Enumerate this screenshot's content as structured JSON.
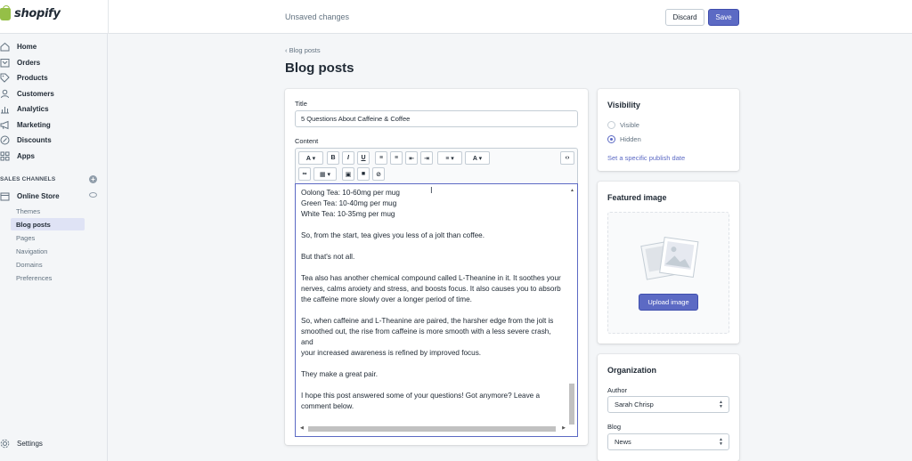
{
  "app": {
    "logo_text": "shopify",
    "brand_color": "#95bf47",
    "accent": "#5c6ac4"
  },
  "topbar": {
    "status": "Unsaved changes",
    "discard_label": "Discard",
    "save_label": "Save"
  },
  "sidebar": {
    "items": [
      {
        "label": "Home",
        "icon": "home-icon"
      },
      {
        "label": "Orders",
        "icon": "orders-icon"
      },
      {
        "label": "Products",
        "icon": "tag-icon"
      },
      {
        "label": "Customers",
        "icon": "person-icon"
      },
      {
        "label": "Analytics",
        "icon": "chart-icon"
      },
      {
        "label": "Marketing",
        "icon": "megaphone-icon"
      },
      {
        "label": "Discounts",
        "icon": "discount-icon"
      },
      {
        "label": "Apps",
        "icon": "apps-icon"
      }
    ],
    "section_title": "SALES CHANNELS",
    "channel": {
      "label": "Online Store",
      "icon": "store-icon"
    },
    "sub_items": [
      "Themes",
      "Blog posts",
      "Pages",
      "Navigation",
      "Domains",
      "Preferences"
    ],
    "settings_label": "Settings"
  },
  "main": {
    "breadcrumb": "Blog posts",
    "title": "Blog posts",
    "title_label": "Title",
    "title_value": "5 Questions About Caffeine & Coffee",
    "content_label": "Content",
    "editor_lines": [
      [
        "Oolong Tea: 10-60mg per mug",
        "Green Tea: 10-40mg per mug",
        "White Tea: 10-35mg per mug"
      ],
      [
        "So, from the start, tea gives you less of a jolt than coffee."
      ],
      [
        "But that's not all."
      ],
      [
        "Tea also has another chemical compound called L-Theanine in it. It soothes your",
        "nerves, calms anxiety and stress, and boosts focus. It also causes you to absorb",
        "the caffeine more slowly over a longer period of time."
      ],
      [
        "So, when caffeine and L-Theanine are paired, the harsher edge from the jolt is",
        "smoothed out, the rise from caffeine is more smooth with a less severe crash, and",
        "your increased awareness is refined by improved focus."
      ],
      [
        "They make a great pair."
      ],
      [
        "I hope this post answered some of your questions! Got anymore? Leave a",
        "comment below."
      ]
    ]
  },
  "visibility": {
    "title": "Visibility",
    "options": [
      {
        "label": "Visible",
        "selected": false
      },
      {
        "label": "Hidden",
        "selected": true
      }
    ],
    "link": "Set a specific publish date"
  },
  "featured": {
    "title": "Featured image",
    "upload_label": "Upload image"
  },
  "organization": {
    "title": "Organization",
    "author_label": "Author",
    "author_value": "Sarah Chrisp",
    "blog_label": "Blog",
    "blog_value": "News"
  }
}
